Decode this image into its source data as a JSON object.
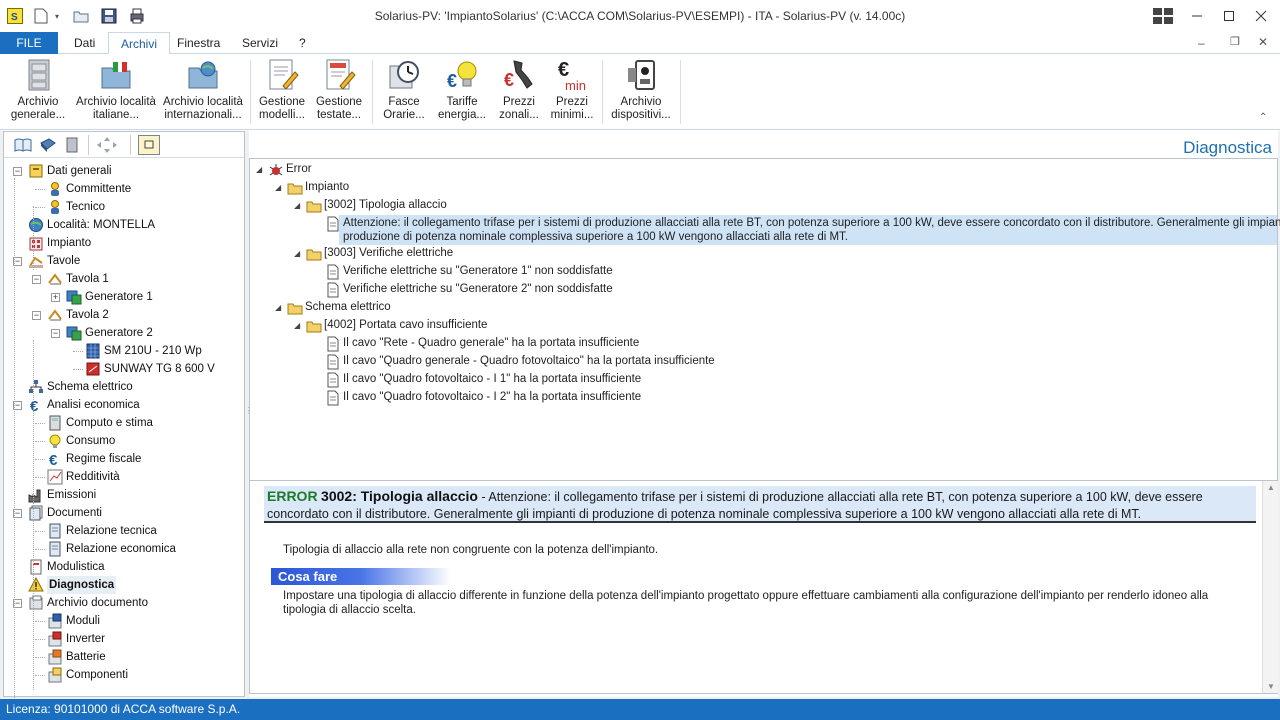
{
  "window": {
    "title": "Solarius-PV: 'ImpiantoSolarius' (C:\\ACCA COM\\Solarius-PV\\ESEMPI) - ITA - Solarius-PV (v. 14.00c)"
  },
  "tabs": [
    {
      "label": "FILE"
    },
    {
      "label": "Dati"
    },
    {
      "label": "Archivi"
    },
    {
      "label": "Finestra"
    },
    {
      "label": "Servizi"
    },
    {
      "label": "?"
    }
  ],
  "ribbon": [
    {
      "line1": "Archivio",
      "line2": "generale...",
      "icon": "cabinet-icon"
    },
    {
      "line1": "Archivio località",
      "line2": "italiane...",
      "icon": "folder-italy-icon"
    },
    {
      "line1": "Archivio località",
      "line2": "internazionali...",
      "icon": "folder-globe-icon"
    },
    {
      "line1": "Gestione",
      "line2": "modelli...",
      "icon": "document-edit-icon"
    },
    {
      "line1": "Gestione",
      "line2": "testate...",
      "icon": "document-header-icon"
    },
    {
      "line1": "Fasce",
      "line2": "Orarie...",
      "icon": "clock-icon"
    },
    {
      "line1": "Tariffe",
      "line2": "energia...",
      "icon": "euro-bulb-icon"
    },
    {
      "line1": "Prezzi",
      "line2": "zonali...",
      "icon": "euro-map-icon"
    },
    {
      "line1": "Prezzi",
      "line2": "minimi...",
      "icon": "euro-min-icon"
    },
    {
      "line1": "Archivio",
      "line2": "dispositivi...",
      "icon": "device-icon"
    }
  ],
  "tree": [
    {
      "label": "Dati generali",
      "level": 0,
      "expander": "-",
      "icon": "dati-generali-icon"
    },
    {
      "label": "Committente",
      "level": 1,
      "icon": "person-icon"
    },
    {
      "label": "Tecnico",
      "level": 1,
      "icon": "person-icon"
    },
    {
      "label": "Località: MONTELLA",
      "level": 0,
      "icon": "globe-icon"
    },
    {
      "label": "Impianto",
      "level": 0,
      "icon": "building-icon"
    },
    {
      "label": "Tavole",
      "level": 0,
      "expander": "-",
      "icon": "tavole-icon"
    },
    {
      "label": "Tavola 1",
      "level": 1,
      "expander": "-",
      "icon": "tavola-icon"
    },
    {
      "label": "Generatore 1",
      "level": 2,
      "expander": "+",
      "icon": "generator-icon"
    },
    {
      "label": "Tavola 2",
      "level": 1,
      "expander": "-",
      "icon": "tavola-icon"
    },
    {
      "label": "Generatore 2",
      "level": 2,
      "expander": "-",
      "icon": "generator-icon"
    },
    {
      "label": "SM 210U - 210 Wp",
      "level": 3,
      "icon": "module-icon"
    },
    {
      "label": "SUNWAY TG 8 600 V",
      "level": 3,
      "icon": "inverter-icon"
    },
    {
      "label": "Schema elettrico",
      "level": 0,
      "icon": "schema-icon"
    },
    {
      "label": "Analisi economica",
      "level": 0,
      "expander": "-",
      "icon": "euro-icon"
    },
    {
      "label": "Computo e stima",
      "level": 1,
      "icon": "calculator-icon"
    },
    {
      "label": "Consumo",
      "level": 1,
      "icon": "bulb-icon"
    },
    {
      "label": "Regime fiscale",
      "level": 1,
      "icon": "euro-icon"
    },
    {
      "label": "Redditività",
      "level": 1,
      "icon": "chart-icon"
    },
    {
      "label": "Emissioni",
      "level": 0,
      "icon": "factory-icon"
    },
    {
      "label": "Documenti",
      "level": 0,
      "expander": "-",
      "icon": "documents-icon"
    },
    {
      "label": "Relazione tecnica",
      "level": 1,
      "icon": "document-icon"
    },
    {
      "label": "Relazione economica",
      "level": 1,
      "icon": "document-icon"
    },
    {
      "label": "Modulistica",
      "level": 0,
      "icon": "forms-icon"
    },
    {
      "label": "Diagnostica",
      "level": 0,
      "icon": "warning-icon",
      "selected": true
    },
    {
      "label": "Archivio documento",
      "level": 0,
      "expander": "-",
      "icon": "archive-icon"
    },
    {
      "label": "Moduli",
      "level": 1,
      "icon": "archive-module-icon"
    },
    {
      "label": "Inverter",
      "level": 1,
      "icon": "archive-inverter-icon"
    },
    {
      "label": "Batterie",
      "level": 1,
      "icon": "archive-battery-icon"
    },
    {
      "label": "Componenti",
      "level": 1,
      "icon": "archive-component-icon"
    }
  ],
  "panel": {
    "title": "Diagnostica"
  },
  "errors": [
    {
      "label": "Error",
      "level": 0,
      "icon": "bug-icon",
      "tri": true
    },
    {
      "label": "Impianto",
      "level": 1,
      "icon": "folder-icon",
      "tri": true
    },
    {
      "label": "[3002] Tipologia allaccio",
      "level": 2,
      "icon": "folder-icon",
      "tri": true
    },
    {
      "label": "Attenzione: il collegamento trifase per i sistemi di produzione allacciati alla rete BT, con potenza superiore a 100 kW, deve essere concordato con il distributore. Generalmente gli impianti di",
      "label2": "produzione di potenza nominale complessiva superiore a 100 kW vengono allacciati alla rete di MT.",
      "level": 3,
      "icon": "doc-icon",
      "selected": true
    },
    {
      "label": "[3003] Verifiche elettriche",
      "level": 2,
      "icon": "folder-icon",
      "tri": true
    },
    {
      "label": "Verifiche elettriche su \"Generatore 1\" non soddisfatte",
      "level": 3,
      "icon": "doc-icon"
    },
    {
      "label": "Verifiche elettriche su \"Generatore 2\" non soddisfatte",
      "level": 3,
      "icon": "doc-icon"
    },
    {
      "label": "Schema elettrico",
      "level": 1,
      "icon": "folder-icon",
      "tri": true
    },
    {
      "label": "[4002] Portata cavo insufficiente",
      "level": 2,
      "icon": "folder-icon",
      "tri": true
    },
    {
      "label": "Il cavo \"Rete - Quadro generale\" ha la portata insufficiente",
      "level": 3,
      "icon": "doc-icon"
    },
    {
      "label": "Il cavo \"Quadro generale - Quadro fotovoltaico\" ha la portata insufficiente",
      "level": 3,
      "icon": "doc-icon"
    },
    {
      "label": "Il cavo \"Quadro fotovoltaico - I 1\" ha la portata insufficiente",
      "level": 3,
      "icon": "doc-icon"
    },
    {
      "label": "Il cavo \"Quadro fotovoltaico - I 2\" ha la portata insufficiente",
      "level": 3,
      "icon": "doc-icon"
    }
  ],
  "detail": {
    "error_word": "ERROR",
    "error_code": "3002: Tipologia allaccio",
    "error_sep": " - ",
    "error_text": "Attenzione: il collegamento trifase per i sistemi di produzione allacciati alla rete BT, con potenza superiore a 100 kW, deve essere concordato con il distributore. Generalmente gli impianti di produzione di potenza nominale complessiva superiore a 100 kW vengono allacciati alla rete di MT.",
    "description": "Tipologia di allaccio alla rete non congruente con la potenza dell'impianto.",
    "section_title": "Cosa fare",
    "section_text": "Impostare una tipologia di allaccio differente in funzione della potenza dell'impianto progettato oppure effettuare cambiamenti alla configurazione dell'impianto per renderlo idoneo alla tipologia di allaccio scelta."
  },
  "splitter": {
    "label": "....."
  },
  "status": {
    "text": "Licenza: 90101000 di ACCA software S.p.A."
  },
  "colors": {
    "accent": "#1b6fc1",
    "error_green": "#1e7a2a",
    "title_blue": "#1e6fb3",
    "selection": "#cfe3f7"
  }
}
